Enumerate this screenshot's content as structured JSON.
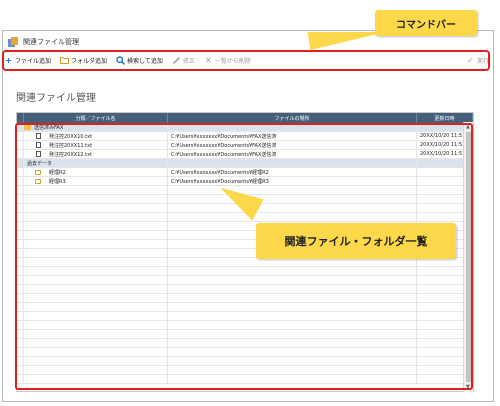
{
  "window": {
    "title": "関連ファイル管理"
  },
  "toolbar": {
    "items": [
      {
        "label": "ファイル追加",
        "icon": "plus-icon",
        "enabled": true
      },
      {
        "label": "フォルダ追加",
        "icon": "folder-icon",
        "enabled": true
      },
      {
        "label": "検索して追加",
        "icon": "search-icon",
        "enabled": true
      },
      {
        "label": "修正",
        "icon": "pencil-icon",
        "enabled": false
      },
      {
        "label": "一覧から削除",
        "icon": "x-icon",
        "enabled": false
      }
    ],
    "execute_label": "実行"
  },
  "callouts": {
    "command_bar": "コマンドバー",
    "list": "関連ファイル・フォルダ一覧"
  },
  "page_title": "関連ファイル管理",
  "grid": {
    "columns": [
      "分類／ファイル名",
      "ファイルの場所",
      "更新日時"
    ],
    "rows": [
      {
        "type": "group",
        "name": "送信済みFAX",
        "path": "",
        "date": ""
      },
      {
        "type": "file",
        "name": "発注控20XX10.txt",
        "path": "C:¥Users¥xxxxxxx¥Documents¥FAX送信済",
        "date": "20XX/10/20 11:51:11"
      },
      {
        "type": "file",
        "name": "発注控20XX11.txt",
        "path": "C:¥Users¥xxxxxxx¥Documents¥FAX送信済",
        "date": "20XX/10/20 11:51:11"
      },
      {
        "type": "file",
        "name": "発注控20XX12.txt",
        "path": "C:¥Users¥xxxxxxx¥Documents¥FAX送信済",
        "date": "20XX/10/20 11:51:11"
      },
      {
        "type": "group",
        "name": "過去データ",
        "path": "",
        "date": ""
      },
      {
        "type": "folder",
        "name": "経理R2",
        "path": "C:¥Users¥xxxxxxx¥Documents¥経理R2",
        "date": ""
      },
      {
        "type": "folder",
        "name": "経理R3",
        "path": "C:¥Users¥xxxxxxx¥Documents¥経理R3",
        "date": ""
      }
    ]
  }
}
